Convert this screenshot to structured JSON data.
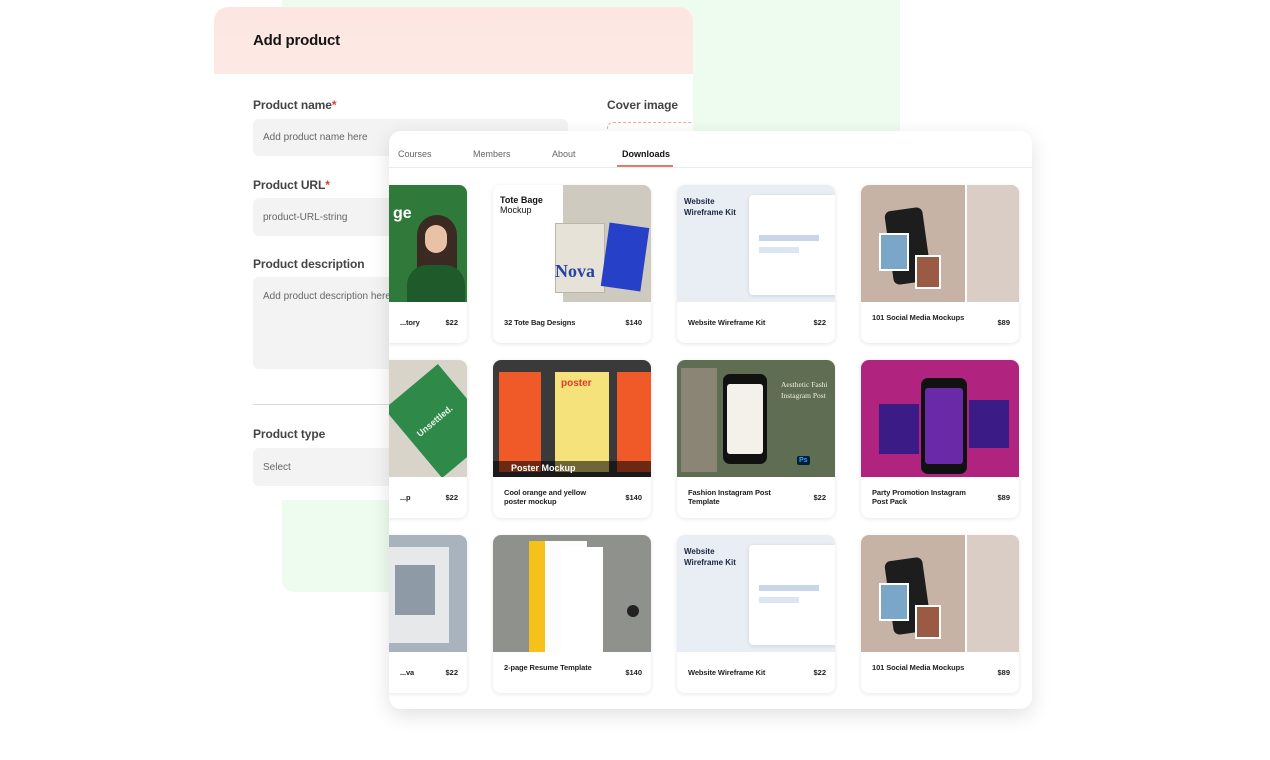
{
  "form": {
    "title": "Add product",
    "product_name_label": "Product name",
    "product_name_placeholder": "Add product name here",
    "product_url_label": "Product URL",
    "product_url_placeholder": "product-URL-string",
    "product_description_label": "Product description",
    "product_description_placeholder": "Add product description here",
    "cover_image_label": "Cover image",
    "product_type_label": "Product type",
    "product_type_placeholder": "Select",
    "required_mark": "*"
  },
  "tabs": [
    {
      "label": "Courses"
    },
    {
      "label": "Members"
    },
    {
      "label": "About"
    },
    {
      "label": "Downloads"
    }
  ],
  "cards": [
    {
      "name": "...tory",
      "price": "$22"
    },
    {
      "name": "32 Tote Bag Designs",
      "price": "$140"
    },
    {
      "name": "Website Wireframe Kit",
      "price": "$22"
    },
    {
      "name": "101 Social Media Mockups",
      "price": "$89"
    },
    {
      "name": "...p",
      "price": "$22"
    },
    {
      "name": "Cool orange and yellow poster mockup",
      "price": "$140"
    },
    {
      "name": "Fashion Instagram Post Template",
      "price": "$22"
    },
    {
      "name": "Party Promotion Instagram Post Pack",
      "price": "$89"
    },
    {
      "name": "...va",
      "price": "$22"
    },
    {
      "name": "2-page Resume Template",
      "price": "$140"
    },
    {
      "name": "Website Wireframe Kit",
      "price": "$22"
    },
    {
      "name": "101 Social Media Mockups",
      "price": "$89"
    }
  ],
  "thumb_text": {
    "tote_title": "Tote Bage",
    "tote_sub": "Mockup",
    "nova": "Nova",
    "wire_title1": "Website",
    "wire_title2": "Wireframe Kit",
    "poster_word": "poster",
    "poster_mockup": "Poster Mockup",
    "fashion_title1": "Aesthetic Fashi",
    "fashion_title2": "Instagram Post",
    "unsettled": "Unsettled.",
    "ge": "ge",
    "ps": "Ps"
  },
  "colors": {
    "accent": "#e57a6a",
    "required": "#e53935",
    "form_header_bg": "#fde6e2",
    "green_bg": "#eefcef"
  }
}
